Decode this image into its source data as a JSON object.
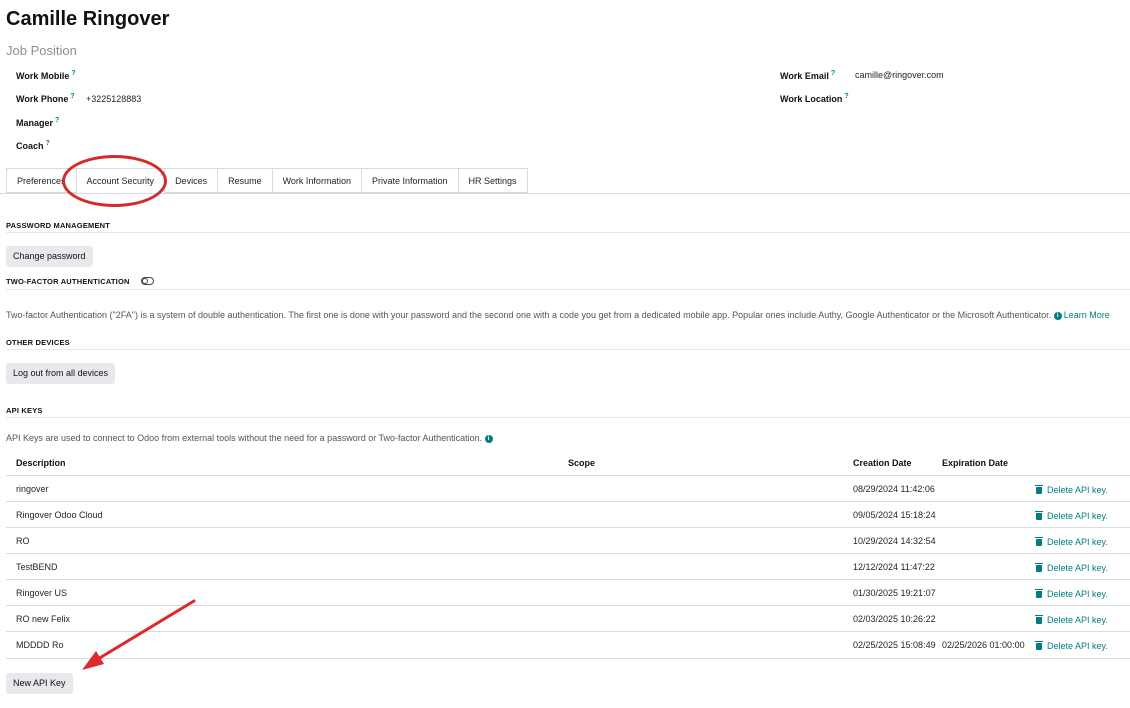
{
  "header": {
    "name": "Camille Ringover",
    "job_position": "Job Position"
  },
  "fields": {
    "work_mobile_label": "Work Mobile",
    "work_phone_label": "Work Phone",
    "work_phone_value": "+3225128883",
    "manager_label": "Manager",
    "coach_label": "Coach",
    "work_email_label": "Work Email",
    "work_email_value": "camille@ringover.com",
    "work_location_label": "Work Location",
    "help_mark": "?"
  },
  "tabs": [
    "Preferences",
    "Account Security",
    "Devices",
    "Resume",
    "Work Information",
    "Private Information",
    "HR Settings"
  ],
  "security": {
    "password_title": "PASSWORD MANAGEMENT",
    "change_password": "Change password",
    "twofa_title": "TWO-FACTOR AUTHENTICATION",
    "twofa_desc": "Two-factor Authentication (\"2FA\") is a system of double authentication. The first one is done with your password and the second one with a code you get from a dedicated mobile app. Popular ones include Authy, Google Authenticator or the Microsoft Authenticator.",
    "learn_more": "Learn More",
    "devices_title": "OTHER DEVICES",
    "logout_all": "Log out from all devices",
    "api_title": "API KEYS",
    "api_desc": "API Keys are used to connect to Odoo from external tools without the need for a password or Two-factor Authentication.",
    "new_api_key": "New API Key"
  },
  "api_table": {
    "headers": {
      "description": "Description",
      "scope": "Scope",
      "creation": "Creation Date",
      "expiration": "Expiration Date"
    },
    "delete_label": "Delete API key.",
    "rows": [
      {
        "description": "ringover",
        "creation": "08/29/2024 11:42:06",
        "expiration": ""
      },
      {
        "description": "Ringover Odoo Cloud",
        "creation": "09/05/2024 15:18:24",
        "expiration": ""
      },
      {
        "description": "RO",
        "creation": "10/29/2024 14:32:54",
        "expiration": ""
      },
      {
        "description": "TestBEND",
        "creation": "12/12/2024 11:47:22",
        "expiration": ""
      },
      {
        "description": "Ringover US",
        "creation": "01/30/2025 19:21:07",
        "expiration": ""
      },
      {
        "description": "RO new Felix",
        "creation": "02/03/2025 10:26:22",
        "expiration": ""
      },
      {
        "description": "MDDDD Ro",
        "creation": "02/25/2025 15:08:49",
        "expiration": "02/25/2026 01:00:00"
      }
    ]
  },
  "annotations": {
    "highlight_color": "#d42a2a"
  }
}
